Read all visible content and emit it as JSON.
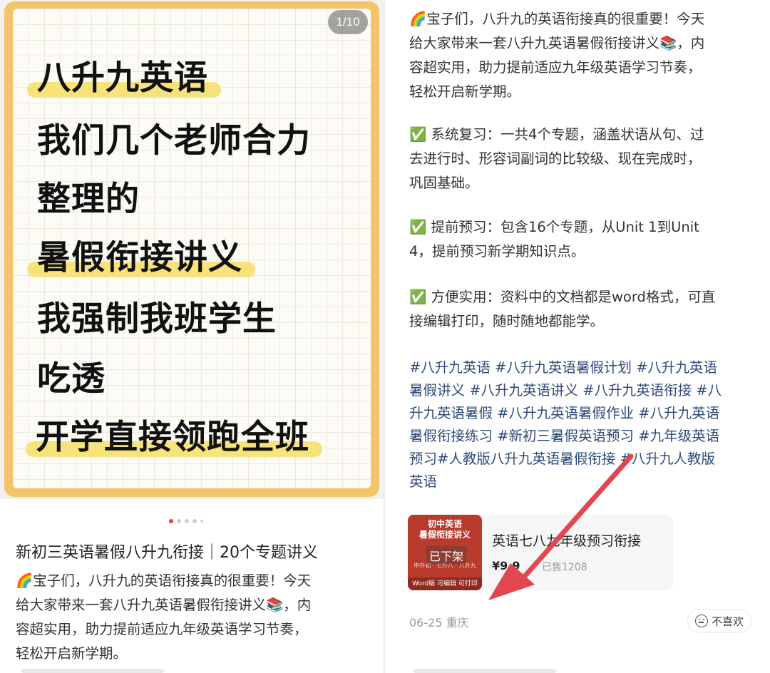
{
  "left_post": {
    "counter": "1/10",
    "cover_lines": [
      "八升九英语",
      "我们几个老师合力",
      "整理的",
      "暑假衔接讲义",
      "我强制我班学生",
      "吃透",
      "开学直接领跑全班"
    ],
    "title": "新初三英语暑假八升九衔接｜20个专题讲义",
    "description": [
      "🌈宝子们，八升九的英语衔接真的很重要！今天",
      "给大家带来一套八升九英语暑假衔接讲义📚，内",
      "容超实用，助力提前适应九年级英语学习节奏，",
      "轻松开启新学期。"
    ]
  },
  "right_post": {
    "intro": [
      "🌈宝子们，八升九的英语衔接真的很重要！今天",
      "给大家带来一套八升九英语暑假衔接讲义📚，内",
      "容超实用，助力提前适应九年级英语学习节奏，",
      "轻松开启新学期。"
    ],
    "point1": [
      "✅ 系统复习：一共4个专题，涵盖状语从句、过",
      "去进行时、形容词副词的比较级、现在完成时，",
      "巩固基础。"
    ],
    "point2": [
      "✅ 提前预习：包含16个专题，从Unit 1到Unit",
      "4，提前预习新学期知识点。"
    ],
    "point3": [
      "✅ 方便实用：资料中的文档都是word格式，可直",
      "接编辑打印，随时随地都能学。"
    ],
    "tags": [
      "#八升九英语 #八升九英语暑假计划 #八升九英语",
      "暑假讲义 #八升九英语讲义 #八升九英语衔接 #八",
      "升九英语暑假 #八升九英语暑假作业 #八升九英语",
      "暑假衔接练习 #新初三暑假英语预习 #九年级英语",
      "预习#人教版八升九英语暑假衔接 #八升九人教版",
      "英语"
    ],
    "product": {
      "thumb_title": "初中英语\n暑假衔接讲义",
      "thumb_sub": "中升初 · 七升八 · 八升九",
      "thumb_foot": "Word版 可编辑 可打印",
      "status": "已下架",
      "name": "英语七八九年级预习衔接",
      "price": "¥9.9",
      "sales": "已售1208"
    },
    "meta": "06-25 重庆",
    "dislike_label": "不喜欢"
  },
  "colors": {
    "cover_border": "#f4c46a",
    "highlight": "#f8e27a",
    "tag_link": "#2d4a7a",
    "arrow": "#e2474f",
    "active_dot": "#e8383d"
  }
}
